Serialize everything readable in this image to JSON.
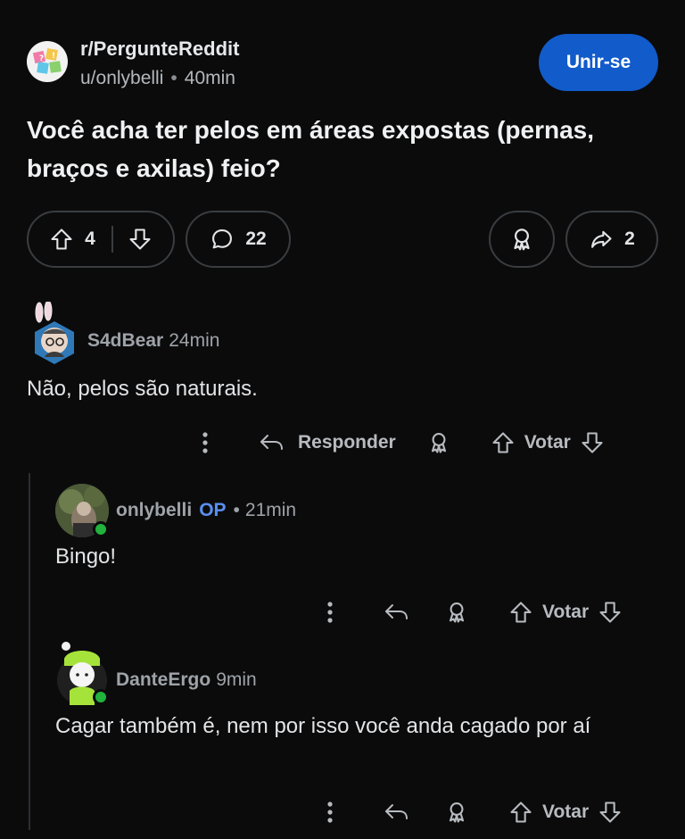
{
  "post": {
    "subreddit": "r/PergunteReddit",
    "author": "u/onlybelli",
    "separator": "•",
    "time": "40min",
    "join_label": "Unir-se",
    "title": "Você acha ter pelos em áreas expostas (pernas, braços e axilas) feio?",
    "upvotes": "4",
    "comments": "22",
    "shares": "2"
  },
  "comments": [
    {
      "author": "S4dBear",
      "time": "24min",
      "body": "Não, pelos são naturais.",
      "reply_label": "Responder",
      "vote_label": "Votar"
    },
    {
      "author": "onlybelli",
      "op_badge": "OP",
      "separator": "•",
      "time": "21min",
      "body": "Bingo!",
      "vote_label": "Votar"
    },
    {
      "author": "DanteErgo",
      "time": "9min",
      "body": "Cagar também é, nem por isso você anda cagado por aí",
      "vote_label": "Votar"
    }
  ],
  "colors": {
    "background": "#0b0b0c",
    "join_button": "#115bca",
    "op_badge": "#5a8ff0",
    "online": "#21b33d"
  },
  "icons": [
    "upvote-icon",
    "downvote-icon",
    "comment-icon",
    "award-icon",
    "share-icon",
    "more-icon",
    "reply-icon"
  ]
}
